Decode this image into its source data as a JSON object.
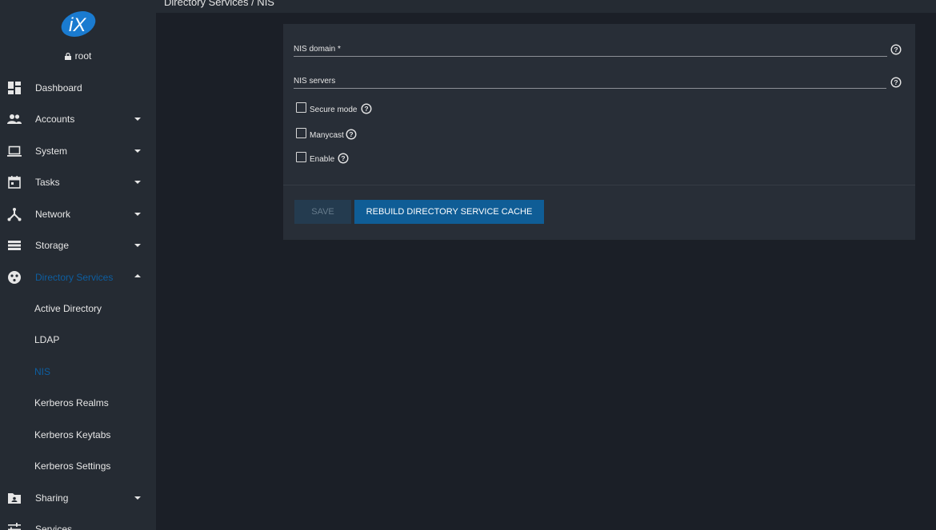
{
  "header": {
    "breadcrumb": "Directory Services  /   NIS"
  },
  "user": {
    "name": "root"
  },
  "sidebar": {
    "items": [
      {
        "label": "Dashboard"
      },
      {
        "label": "Accounts"
      },
      {
        "label": "System"
      },
      {
        "label": "Tasks"
      },
      {
        "label": "Network"
      },
      {
        "label": "Storage"
      },
      {
        "label": "Directory Services"
      },
      {
        "label": "Sharing"
      },
      {
        "label": "Services"
      }
    ],
    "directory_services_children": [
      {
        "label": "Active Directory"
      },
      {
        "label": "LDAP"
      },
      {
        "label": "NIS"
      },
      {
        "label": "Kerberos Realms"
      },
      {
        "label": "Kerberos Keytabs"
      },
      {
        "label": "Kerberos Settings"
      }
    ]
  },
  "form": {
    "nis_domain_label": "NIS domain *",
    "nis_domain_value": "",
    "nis_servers_label": "NIS servers",
    "nis_servers_value": "",
    "secure_mode_label": "Secure mode",
    "manycast_label": "Manycast",
    "enable_label": "Enable",
    "save_label": "SAVE",
    "rebuild_label": "REBUILD DIRECTORY SERVICE CACHE"
  },
  "colors": {
    "accent": "#0f5d96",
    "active_nav": "#0e5ea0",
    "sidebar_bg": "#252b33",
    "page_bg": "#1b1f27",
    "card_bg": "#282e37"
  }
}
